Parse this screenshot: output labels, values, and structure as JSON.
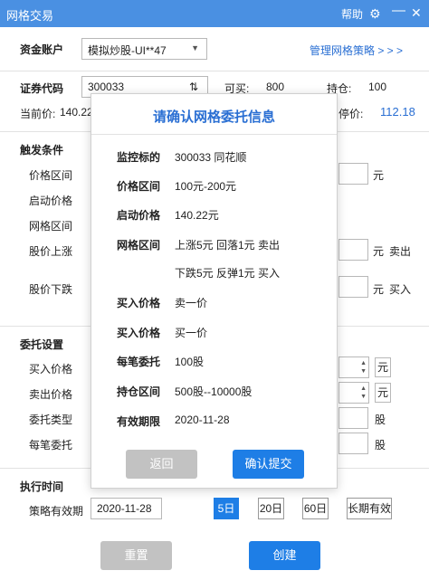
{
  "window": {
    "title": "网格交易",
    "help": "帮助",
    "minimize": "—",
    "close": "✕"
  },
  "account": {
    "label": "资金账户",
    "value": "模拟炒股-UI**47",
    "manage_link": "管理网格策略 > > >"
  },
  "security": {
    "label": "证券代码",
    "code": "300033",
    "sort_icon": "⇅",
    "buyable_label": "可买:",
    "buyable_value": "800",
    "position_label": "持仓:",
    "position_value": "100",
    "current_price_label": "当前价:",
    "current_price_value": "140.22",
    "stop_price_label": "停价:",
    "stop_price_value": "112.18"
  },
  "trigger": {
    "section": "触发条件",
    "price_range_label": "价格区间",
    "start_price_label": "启动价格",
    "grid_range_label": "网格区间",
    "rise_label": "股价上涨",
    "fall_label": "股价下跌",
    "yuan": "元",
    "sell_label": "卖出",
    "buy_label": "买入"
  },
  "order": {
    "section": "委托设置",
    "buy_price_label": "买入价格",
    "sell_price_label": "卖出价格",
    "order_type_label": "委托类型",
    "per_order_label": "每笔委托",
    "yuan": "元",
    "shares": "股"
  },
  "execution": {
    "section": "执行时间",
    "valid_label": "策略有效期",
    "date": "2020-11-28",
    "options": [
      "5日",
      "20日",
      "60日",
      "长期有效"
    ],
    "active_index": 0
  },
  "buttons": {
    "reset": "重置",
    "create": "创建"
  },
  "modal": {
    "title": "请确认网格委托信息",
    "rows": [
      {
        "label": "监控标的",
        "value": "300033   同花顺"
      },
      {
        "label": "价格区间",
        "value": "100元-200元"
      },
      {
        "label": "启动价格",
        "value": "140.22元"
      },
      {
        "label": "网格区间",
        "value": "上涨5元  回落1元  卖出"
      },
      {
        "label": "",
        "value": "下跌5元  反弹1元  买入"
      },
      {
        "label": "买入价格",
        "value": "卖一价"
      },
      {
        "label": "买入价格",
        "value": "买一价"
      },
      {
        "label": "每笔委托",
        "value": "100股"
      },
      {
        "label": "持仓区间",
        "value": "500股--10000股"
      },
      {
        "label": "有效期限",
        "value": "2020-11-28"
      }
    ],
    "back_button": "返回",
    "confirm_button": "确认提交"
  },
  "colors": {
    "titlebar": "#4a90e2",
    "accent": "#1e7ee6",
    "link": "#2a6fd3",
    "disabled": "#c2c2c2"
  }
}
